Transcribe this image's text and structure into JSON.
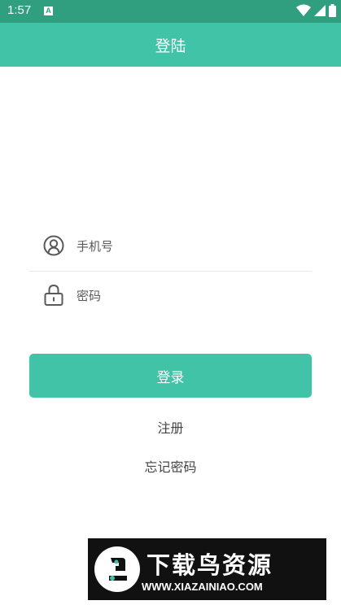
{
  "status_bar": {
    "time": "1:57",
    "notification_icon_letter": "A",
    "icons": [
      "wifi-icon",
      "cellular-signal-icon",
      "battery-icon"
    ]
  },
  "app_bar": {
    "title": "登陆"
  },
  "form": {
    "phone": {
      "placeholder": "手机号",
      "icon": "user-avatar-icon"
    },
    "password": {
      "placeholder": "密码",
      "icon": "lock-icon"
    }
  },
  "buttons": {
    "login": "登录",
    "register": "注册",
    "forgot_password": "忘记密码"
  },
  "watermark": {
    "title": "下载鸟资源",
    "url": "WWW.XIAZAINIAO.COM"
  },
  "colors": {
    "status_bar": "#2f9f80",
    "primary": "#40c3a6",
    "text": "#444444"
  }
}
